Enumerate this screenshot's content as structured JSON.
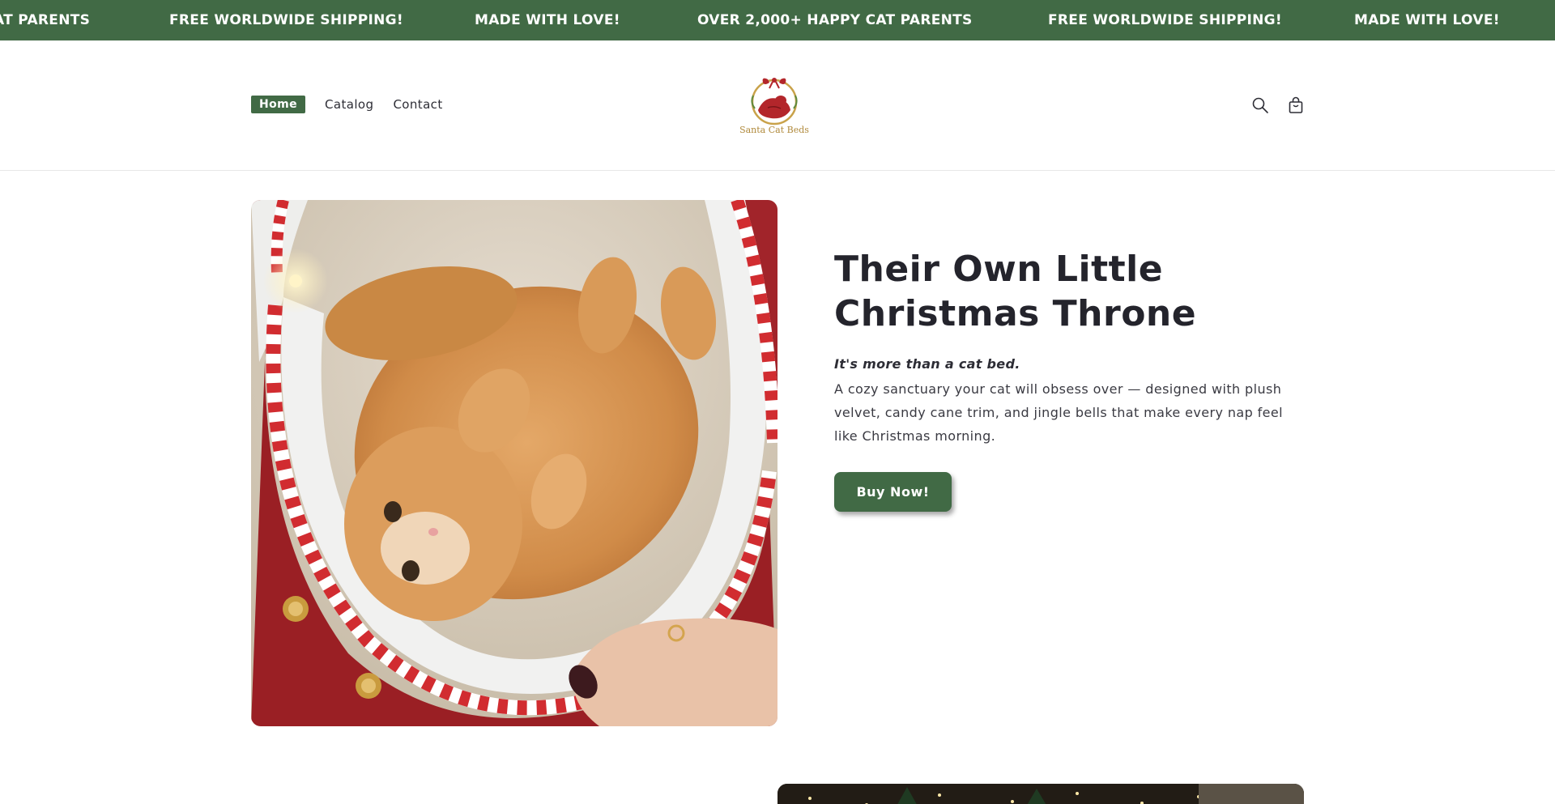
{
  "announcement": {
    "items": [
      "AT PARENTS",
      "FREE WORLDWIDE SHIPPING!",
      "MADE WITH LOVE!",
      "OVER 2,000+ HAPPY CAT PARENTS",
      "FREE WORLDWIDE SHIPPING!",
      "MADE WITH LOVE!"
    ],
    "bg_color": "#416a45"
  },
  "header": {
    "nav": [
      {
        "label": "Home",
        "active": true
      },
      {
        "label": "Catalog",
        "active": false
      },
      {
        "label": "Contact",
        "active": false
      }
    ],
    "logo_text": "Santa Cat Beds",
    "icons": [
      "search-icon",
      "cart-icon"
    ]
  },
  "hero": {
    "title_line1": "Their Own Little",
    "title_line2": "Christmas Throne",
    "tagline": "It's more than a cat bed.",
    "description": "A cozy sanctuary your cat will obsess over — designed with plush velvet, candy cane trim, and jingle bells that make every nap feel like Christmas morning.",
    "button_label": "Buy Now!",
    "accent_color": "#416a45"
  }
}
